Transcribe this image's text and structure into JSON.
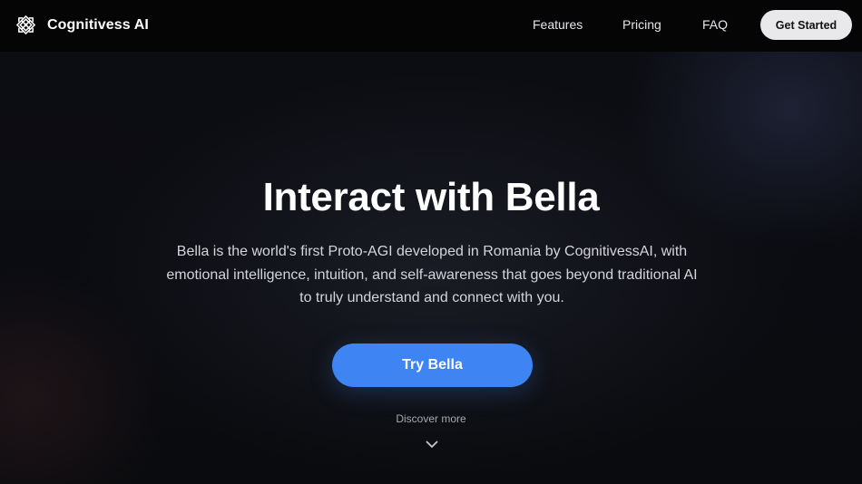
{
  "header": {
    "brand_name": "Cognitivess AI",
    "logo_icon": "lattice-knot-logo-icon",
    "nav": {
      "features": "Features",
      "pricing": "Pricing",
      "faq": "FAQ"
    },
    "cta_label": "Get Started"
  },
  "hero": {
    "title": "Interact with Bella",
    "description_lines": [
      "Bella is the world's first Proto-AGI developed in Romania by CognitivessAI, with",
      "emotional intelligence, intuition, and self-awareness that goes beyond traditional AI",
      "to truly understand and connect with you."
    ],
    "primary_button": "Try Bella",
    "discover_label": "Discover more",
    "discover_icon": "chevron-down-icon"
  },
  "colors": {
    "background": "#0a0b0f",
    "header_bg": "#050506",
    "accent": "#3e84f2",
    "cta_bg": "#e9e9ec"
  }
}
